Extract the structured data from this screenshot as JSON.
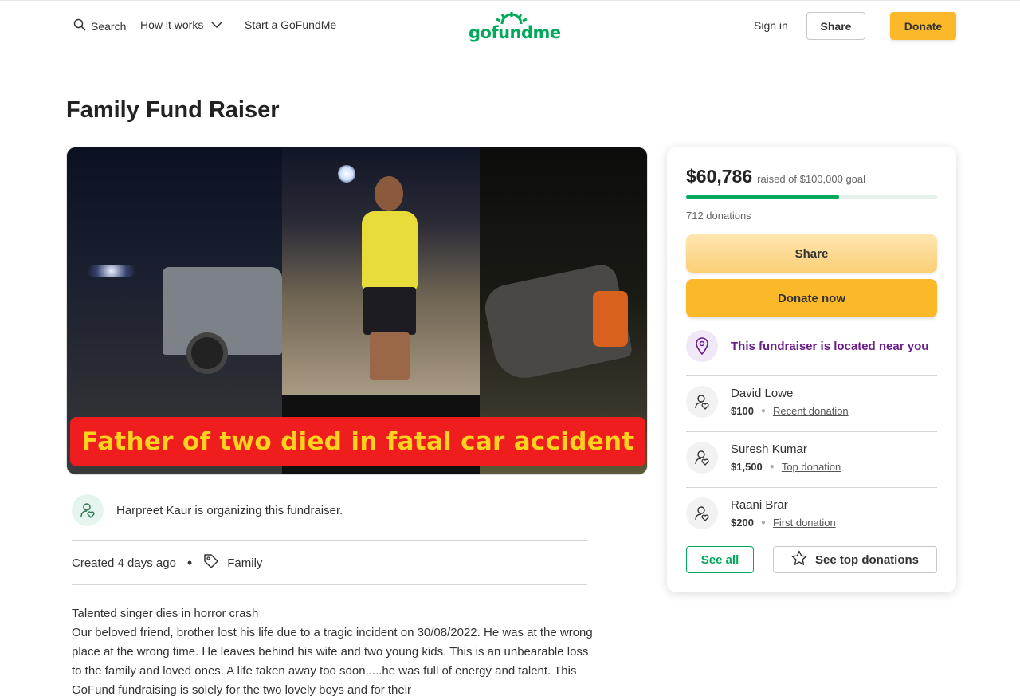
{
  "header": {
    "search_label": "Search",
    "how_it_works_label": "How it works",
    "start_label": "Start a GoFundMe",
    "logo_text": "gofundme",
    "signin_label": "Sign in",
    "share_label": "Share",
    "donate_label": "Donate"
  },
  "campaign": {
    "title": "Family Fund Raiser",
    "image_caption": "Father of two died in fatal car accident",
    "organizer_text": "Harpreet Kaur is organizing this fundraiser.",
    "created": "Created 4 days ago",
    "category": "Family",
    "story_lines": [
      "Talented singer dies in horror crash",
      "Our beloved friend, brother lost his life due to a tragic incident on 30/08/2022. He was at the wrong place at the wrong time. He leaves behind his wife and two young kids. This is an unbearable loss to the family and loved ones. A life taken away too soon.....he was full of energy and talent. This GoFund fundraising is solely for the two lovely boys and for their"
    ]
  },
  "donation_card": {
    "raised_amount": "$60,786",
    "goal_text": "raised of $100,000 goal",
    "progress_fraction": 0.608,
    "donations_count": "712 donations",
    "share_label": "Share",
    "donate_now_label": "Donate now",
    "location_text": "This fundraiser is located near you",
    "donors": [
      {
        "name": "David Lowe",
        "amount": "$100",
        "type": "Recent donation"
      },
      {
        "name": "Suresh Kumar",
        "amount": "$1,500",
        "type": "Top donation"
      },
      {
        "name": "Raani Brar",
        "amount": "$200",
        "type": "First donation"
      }
    ],
    "see_all_label": "See all",
    "see_top_label": "See top donations"
  },
  "colors": {
    "brand_green": "#02a95c",
    "donate_yellow": "#fbb829",
    "location_purple": "#6b1d8a"
  },
  "icons": [
    "search-icon",
    "chevron-down-icon",
    "user-heart-icon",
    "tag-icon",
    "location-pin-icon",
    "star-icon"
  ]
}
